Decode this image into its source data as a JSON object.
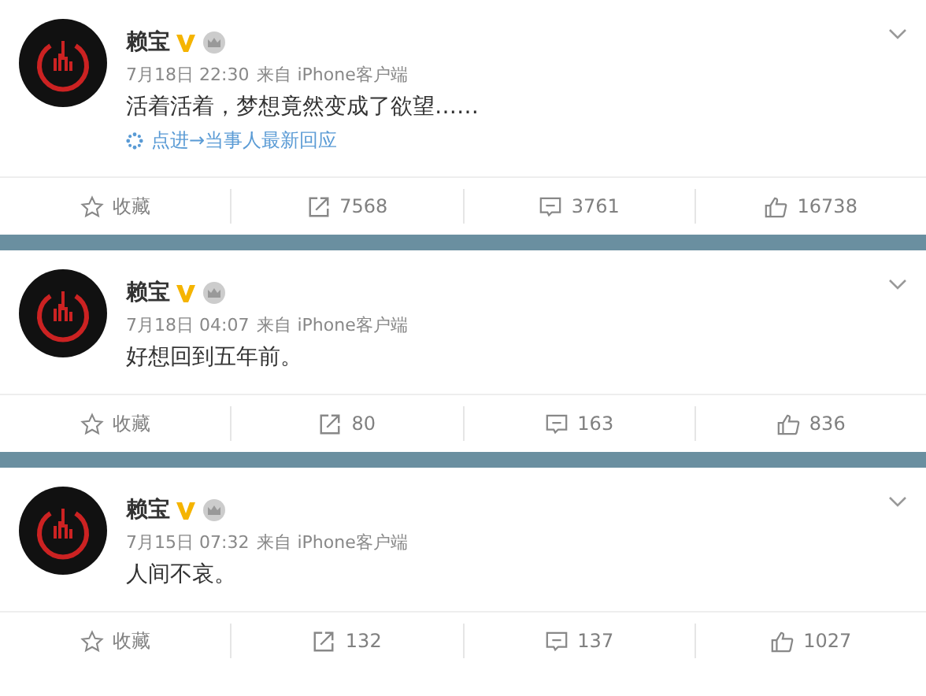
{
  "posts": [
    {
      "author": "赖宝",
      "time": "7月18日 22:30",
      "source": "来自 iPhone客户端",
      "text": "活着活着，梦想竟然变成了欲望……",
      "link": "点进→当事人最新回应",
      "actions": [
        {
          "kind": "favorite",
          "label": "收藏"
        },
        {
          "kind": "repost",
          "label": "7568"
        },
        {
          "kind": "comment",
          "label": "3761"
        },
        {
          "kind": "like",
          "label": "16738"
        }
      ]
    },
    {
      "author": "赖宝",
      "time": "7月18日 04:07",
      "source": "来自 iPhone客户端",
      "text": "好想回到五年前。",
      "actions": [
        {
          "kind": "favorite",
          "label": "收藏"
        },
        {
          "kind": "repost",
          "label": "80"
        },
        {
          "kind": "comment",
          "label": "163"
        },
        {
          "kind": "like",
          "label": "836"
        }
      ]
    },
    {
      "author": "赖宝",
      "time": "7月15日 07:32",
      "source": "来自 iPhone客户端",
      "text": "人间不哀。",
      "actions": [
        {
          "kind": "favorite",
          "label": "收藏"
        },
        {
          "kind": "repost",
          "label": "132"
        },
        {
          "kind": "comment",
          "label": "137"
        },
        {
          "kind": "like",
          "label": "1027"
        }
      ]
    }
  ]
}
